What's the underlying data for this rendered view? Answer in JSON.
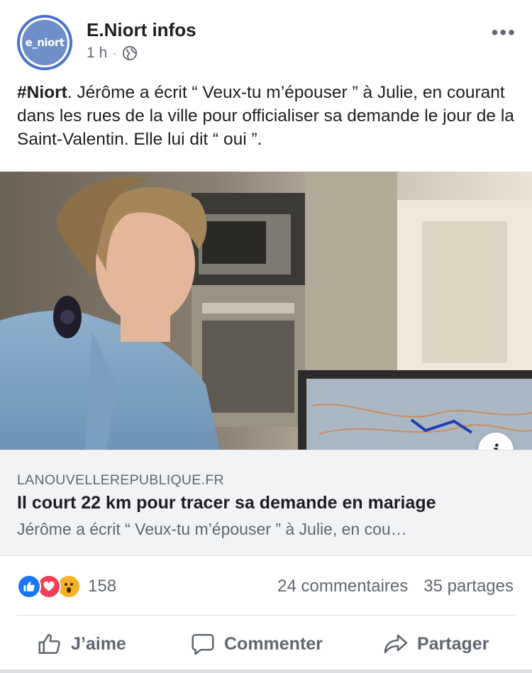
{
  "post": {
    "page_name": "E.Niort infos",
    "avatar_text": "e_niort",
    "time": "1 h",
    "separator": "·",
    "hashtag": "#Niort",
    "text": ". Jérôme a écrit “ Veux-tu m’épouser ” à Julie, en courant dans les rues de la ville pour officialiser sa demande le jour de la Saint-Valentin. Elle lui dit “ oui ”.",
    "more_icon": "•••"
  },
  "link": {
    "domain": "LANOUVELLEREPUBLIQUE.FR",
    "title": "Il court 22 km pour tracer sa demande en mariage",
    "description": "Jérôme a écrit “ Veux-tu m’épouser ” à Julie, en cou…",
    "info_icon": "i"
  },
  "stats": {
    "reactions_count": "158",
    "comments": "24 commentaires",
    "shares": "35 partages"
  },
  "actions": {
    "like": "J’aime",
    "comment": "Commenter",
    "share": "Partager"
  },
  "colors": {
    "like_blue": "#1877f2",
    "love_red": "#f33e58",
    "wow_yellow": "#f7b125",
    "secondary_text": "#606770",
    "link_bg": "#f2f3f5"
  }
}
